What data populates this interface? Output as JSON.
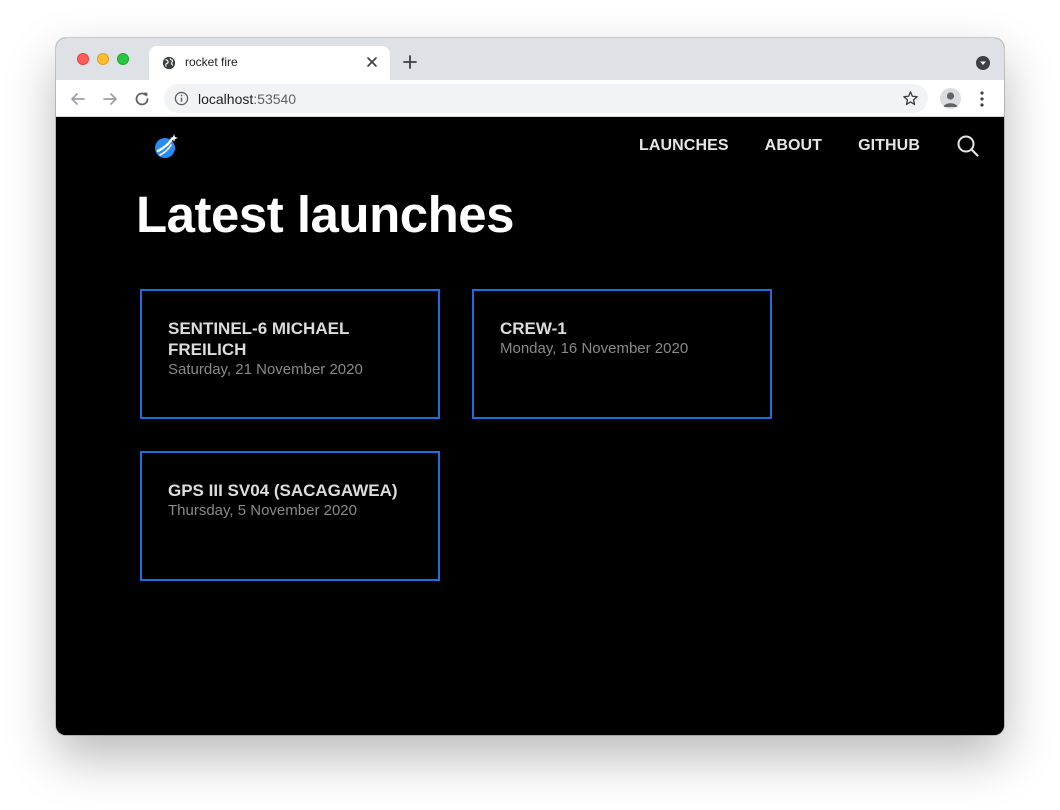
{
  "browser": {
    "tab_title": "rocket fire",
    "url_host": "localhost",
    "url_port": ":53540"
  },
  "site": {
    "nav": [
      {
        "label": "LAUNCHES"
      },
      {
        "label": "ABOUT"
      },
      {
        "label": "GITHUB"
      }
    ],
    "title": "Latest launches",
    "launches": [
      {
        "name": "SENTINEL-6 MICHAEL FREILICH",
        "date": "Saturday, 21 November 2020"
      },
      {
        "name": "CREW-1",
        "date": "Monday, 16 November 2020"
      },
      {
        "name": "GPS III SV04 (SACAGAWEA)",
        "date": "Thursday, 5 November 2020"
      }
    ]
  },
  "colors": {
    "card_border": "#1a6fe0",
    "page_background": "#000000"
  },
  "icons": [
    "globe-icon",
    "close-icon",
    "plus-icon",
    "chevron-down-icon",
    "back-arrow-icon",
    "forward-arrow-icon",
    "reload-icon",
    "info-icon",
    "star-icon",
    "profile-icon",
    "more-vert-icon",
    "rocket-logo-icon",
    "search-icon"
  ]
}
